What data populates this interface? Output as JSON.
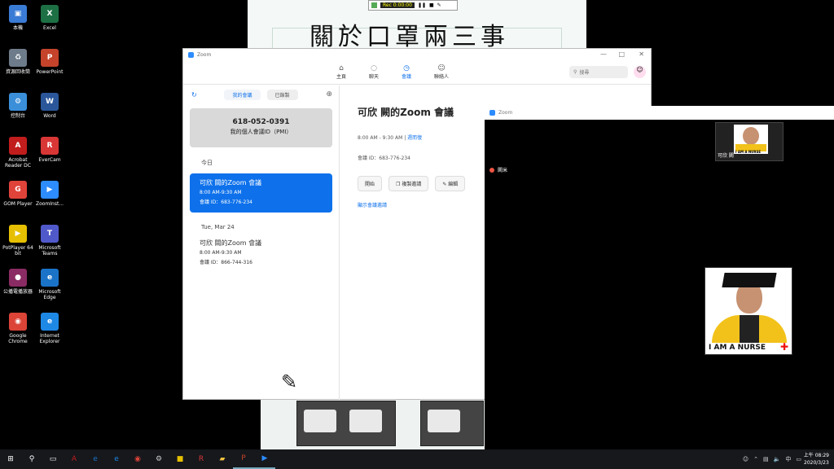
{
  "desktop": {
    "icons": [
      {
        "label": "本機",
        "glyph": "▣",
        "color": "#3a7bd5"
      },
      {
        "label": "Excel",
        "glyph": "X",
        "color": "#1d7044"
      },
      {
        "label": "資源回收筒",
        "glyph": "♻",
        "color": "#6d7b8a"
      },
      {
        "label": "PowerPoint",
        "glyph": "P",
        "color": "#c4432a"
      },
      {
        "label": "控制台",
        "glyph": "⚙",
        "color": "#3b8fd9"
      },
      {
        "label": "Word",
        "glyph": "W",
        "color": "#2b579a"
      },
      {
        "label": "Acrobat Reader DC",
        "glyph": "A",
        "color": "#c11d1d"
      },
      {
        "label": "EverCam",
        "glyph": "R",
        "color": "#d93636"
      },
      {
        "label": "GOM Player",
        "glyph": "G",
        "color": "#e0433a"
      },
      {
        "label": "ZoomInst...",
        "glyph": "▶",
        "color": "#2d8cff"
      },
      {
        "label": "PotPlayer 64 bit",
        "glyph": "▶",
        "color": "#e6c000"
      },
      {
        "label": "Microsoft Teams",
        "glyph": "T",
        "color": "#5059c9"
      },
      {
        "label": "公播電播放器",
        "glyph": "●",
        "color": "#8a2b63"
      },
      {
        "label": "Microsoft Edge",
        "glyph": "e",
        "color": "#1b73c8"
      },
      {
        "label": "Google Chrome",
        "glyph": "◉",
        "color": "#db4437"
      },
      {
        "label": "Internet Explorer",
        "glyph": "e",
        "color": "#1e88e5"
      }
    ]
  },
  "slide": {
    "title": "關於口罩兩三事",
    "rec_text": "Rec 0:00:00"
  },
  "zoom_main": {
    "window_title": "Zoom",
    "nav": [
      {
        "label": "主頁",
        "icon": "home-icon",
        "glyph": "⌂",
        "active": false
      },
      {
        "label": "聊天",
        "icon": "chat-icon",
        "glyph": "◌",
        "active": false
      },
      {
        "label": "會議",
        "icon": "clock-icon",
        "glyph": "◷",
        "active": true
      },
      {
        "label": "聯絡人",
        "icon": "contacts-icon",
        "glyph": "☺",
        "active": false
      }
    ],
    "search_placeholder": "搜尋",
    "sidebar": {
      "tab_upcoming": "我的會議",
      "tab_recorded": "已錄製",
      "pmi_number": "618-052-0391",
      "pmi_label": "我的個人會議ID（PMI）",
      "today_label": "今日",
      "selected_meeting": {
        "title": "可欣 闕的Zoom 會議",
        "time": "8:00 AM-9:30 AM",
        "id": "會議 ID：683-776-234"
      },
      "other_day_label": "Tue, Mar 24",
      "other_meeting": {
        "title": "可欣 闕的Zoom 會議",
        "time": "8:00 AM-9:30 AM",
        "id": "會議 ID：866-744-316"
      }
    },
    "detail": {
      "title": "可欣 闕的Zoom 會議",
      "time": "8:00 AM - 9:30 AM",
      "recurring": "週而復",
      "meeting_id": "會議 ID：683-776-234",
      "btn_start": "開始",
      "btn_copy": "複製邀請",
      "btn_edit": "編輯",
      "invite_link": "顯示會議邀請"
    }
  },
  "zoom_meeting": {
    "window_title": "Zoom",
    "thumb_name": "可欣 闕",
    "thumb_caption": "I AM A NURSE",
    "speaker_name": "闕米",
    "profile_caption": "I AM A NURSE"
  },
  "taskbar": {
    "items": [
      {
        "name": "start-button",
        "glyph": "⊞",
        "color": "#ffffff"
      },
      {
        "name": "search-button",
        "glyph": "⚲",
        "color": "#ffffff"
      },
      {
        "name": "task-view-button",
        "glyph": "▭",
        "color": "#ffffff"
      },
      {
        "name": "taskbar-acrobat",
        "glyph": "A",
        "color": "#c11d1d"
      },
      {
        "name": "taskbar-edge",
        "glyph": "e",
        "color": "#1b73c8"
      },
      {
        "name": "taskbar-ie",
        "glyph": "e",
        "color": "#1e88e5"
      },
      {
        "name": "taskbar-chrome",
        "glyph": "◉",
        "color": "#db4437"
      },
      {
        "name": "taskbar-settings",
        "glyph": "⚙",
        "color": "#cccccc"
      },
      {
        "name": "taskbar-sticky",
        "glyph": "■",
        "color": "#e6c000"
      },
      {
        "name": "taskbar-evercam",
        "glyph": "R",
        "color": "#d93636"
      },
      {
        "name": "taskbar-explorer",
        "glyph": "▰",
        "color": "#f0c040"
      },
      {
        "name": "taskbar-powerpoint",
        "glyph": "P",
        "color": "#c4432a"
      },
      {
        "name": "taskbar-zoom",
        "glyph": "▶",
        "color": "#2d8cff"
      }
    ],
    "clock_time": "上午 08:29",
    "clock_date": "2020/3/23"
  }
}
